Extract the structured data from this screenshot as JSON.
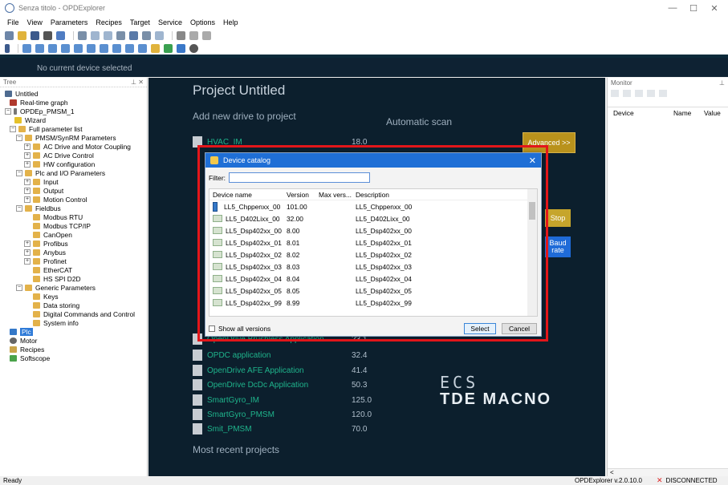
{
  "window": {
    "title": "Senza titolo - OPDExplorer",
    "controls": [
      "—",
      "☐",
      "✕"
    ]
  },
  "menu": [
    "File",
    "View",
    "Parameters",
    "Recipes",
    "Target",
    "Service",
    "Options",
    "Help"
  ],
  "device_strip": {
    "text": "No current device selected"
  },
  "tree": {
    "panel_title": "Tree",
    "nodes": [
      {
        "label": "Untitled"
      },
      {
        "label": "Real-time graph"
      },
      {
        "label": "OPDEp_PMSM_1"
      },
      {
        "label": "Wizard"
      },
      {
        "label": "Full parameter list"
      },
      {
        "label": "PMSM/SynRM Parameters"
      },
      {
        "label": "AC Drive and Motor Coupling"
      },
      {
        "label": "AC Drive Control"
      },
      {
        "label": "HW configuration"
      },
      {
        "label": "Plc and I/O Parameters"
      },
      {
        "label": "Input"
      },
      {
        "label": "Output"
      },
      {
        "label": "Motion Control"
      },
      {
        "label": "Fieldbus"
      },
      {
        "label": "Modbus RTU"
      },
      {
        "label": "Modbus TCP/IP"
      },
      {
        "label": "CanOpen"
      },
      {
        "label": "Profibus"
      },
      {
        "label": "Anybus"
      },
      {
        "label": "Profinet"
      },
      {
        "label": "EtherCAT"
      },
      {
        "label": "HS SPI D2D"
      },
      {
        "label": "Generic Parameters"
      },
      {
        "label": "Keys"
      },
      {
        "label": "Data storing"
      },
      {
        "label": "Digital Commands and Control"
      },
      {
        "label": "System info"
      },
      {
        "label": "Plc"
      },
      {
        "label": "Motor"
      },
      {
        "label": "Recipes"
      },
      {
        "label": "Softscope"
      }
    ]
  },
  "main": {
    "title": "Project Untitled",
    "add_drive": "Add new drive to project",
    "automatic_scan": "Automatic scan",
    "advanced_button": "Advanced >>",
    "stop_button": "Stop",
    "baud_button": "Baud rate",
    "most_recent": "Most recent projects",
    "drives": [
      {
        "name": "HVAC_IM",
        "version": "18.0"
      },
      {
        "name": "OpenDrive Brushless Application",
        "version": "23.1"
      },
      {
        "name": "OPDC application",
        "version": "32.4"
      },
      {
        "name": "OpenDrive AFE Application",
        "version": "41.4"
      },
      {
        "name": "OpenDrive DcDc Application",
        "version": "50.3"
      },
      {
        "name": "SmartGyro_IM",
        "version": "125.0"
      },
      {
        "name": "SmartGyro_PMSM",
        "version": "120.0"
      },
      {
        "name": "Smit_PMSM",
        "version": "70.0"
      }
    ],
    "logo_top": "ECS",
    "logo_bottom": "TDE MACNO"
  },
  "monitor": {
    "panel_title": "Monitor",
    "columns": [
      "Device",
      "Name",
      "Value"
    ],
    "scroll_left": "<"
  },
  "dialog": {
    "title": "Device catalog",
    "filter_label": "Filter:",
    "filter_value": "",
    "columns": [
      "Device name",
      "Version",
      "Max vers...",
      "Description"
    ],
    "rows": [
      {
        "name": "LL5_Chppenxx_00",
        "version": "101.00",
        "max": "",
        "desc": "LL5_Chppenxx_00"
      },
      {
        "name": "LL5_D402Lixx_00",
        "version": "32.00",
        "max": "",
        "desc": "LL5_D402Lixx_00"
      },
      {
        "name": "LL5_Dsp402xx_00",
        "version": "8.00",
        "max": "",
        "desc": "LL5_Dsp402xx_00"
      },
      {
        "name": "LL5_Dsp402xx_01",
        "version": "8.01",
        "max": "",
        "desc": "LL5_Dsp402xx_01"
      },
      {
        "name": "LL5_Dsp402xx_02",
        "version": "8.02",
        "max": "",
        "desc": "LL5_Dsp402xx_02"
      },
      {
        "name": "LL5_Dsp402xx_03",
        "version": "8.03",
        "max": "",
        "desc": "LL5_Dsp402xx_03"
      },
      {
        "name": "LL5_Dsp402xx_04",
        "version": "8.04",
        "max": "",
        "desc": "LL5_Dsp402xx_04"
      },
      {
        "name": "LL5_Dsp402xx_05",
        "version": "8.05",
        "max": "",
        "desc": "LL5_Dsp402xx_05"
      },
      {
        "name": "LL5_Dsp402xx_99",
        "version": "8.99",
        "max": "",
        "desc": "LL5_Dsp402xx_99"
      }
    ],
    "show_all_versions": "Show all versions",
    "select_button": "Select",
    "cancel_button": "Cancel"
  },
  "status": {
    "left": "Ready",
    "version": "OPDExplorer v.2.0.10.0",
    "connection": "DISCONNECTED"
  },
  "colors": {
    "main_bg": "#0c1f2d",
    "drive_name": "#1fb48c",
    "dialog_title": "#1f6fd6",
    "highlight": "#e3161a"
  }
}
